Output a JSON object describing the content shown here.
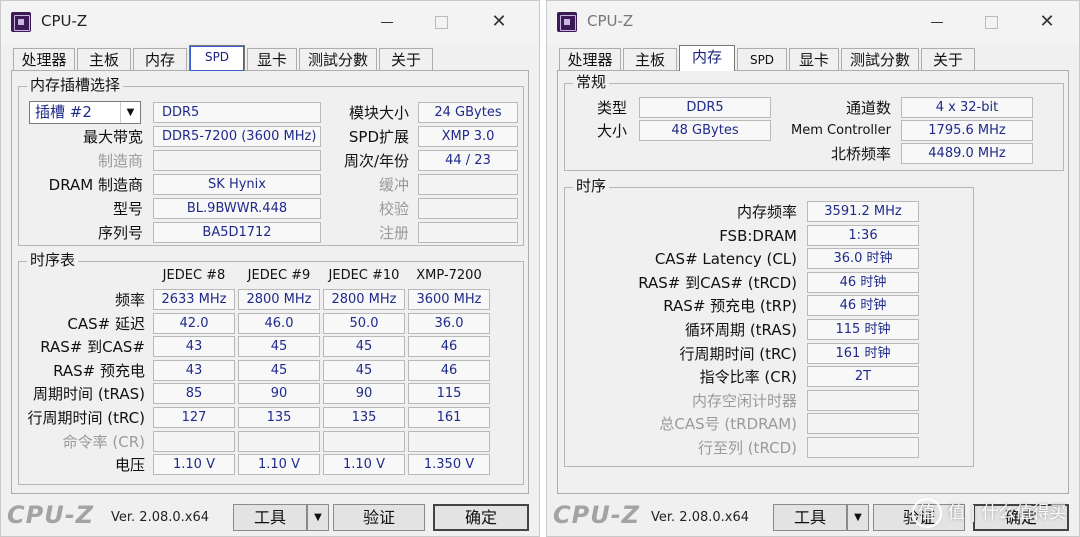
{
  "left": {
    "window_title": "CPU-Z",
    "tabs": [
      "处理器",
      "主板",
      "内存",
      "SPD",
      "显卡",
      "测試分數",
      "关于"
    ],
    "active_tab": "SPD",
    "slot_group_title": "内存插槽选择",
    "slot_select": "插槽 #2",
    "memory_type": "DDR5",
    "labels": {
      "module_size": "模块大小",
      "max_bandwidth": "最大带宽",
      "spd_ext": "SPD扩展",
      "manufacturer": "制造商",
      "week_year": "周次/年份",
      "dram_mfr": "DRAM 制造商",
      "buffered": "缓冲",
      "part_number": "型号",
      "correction": "校验",
      "serial_number": "序列号",
      "registered": "注册"
    },
    "values": {
      "module_size": "24 GBytes",
      "max_bandwidth": "DDR5-7200 (3600 MHz)",
      "spd_ext": "XMP 3.0",
      "manufacturer": "",
      "week_year": "44 / 23",
      "dram_mfr": "SK Hynix",
      "buffered": "",
      "part_number": "BL.9BWWR.448",
      "correction": "",
      "serial_number": "BA5D1712",
      "registered": ""
    },
    "timings_title": "时序表",
    "timing_columns": [
      "JEDEC #8",
      "JEDEC #9",
      "JEDEC #10",
      "XMP-7200"
    ],
    "timing_rows": [
      {
        "label": "频率",
        "values": [
          "2633 MHz",
          "2800 MHz",
          "2800 MHz",
          "3600 MHz"
        ],
        "dim": false
      },
      {
        "label": "CAS# 延迟",
        "values": [
          "42.0",
          "46.0",
          "50.0",
          "36.0"
        ],
        "dim": false
      },
      {
        "label": "RAS# 到CAS#",
        "values": [
          "43",
          "45",
          "45",
          "46"
        ],
        "dim": false
      },
      {
        "label": "RAS# 预充电",
        "values": [
          "43",
          "45",
          "45",
          "46"
        ],
        "dim": false
      },
      {
        "label": "周期时间 (tRAS)",
        "values": [
          "85",
          "90",
          "90",
          "115"
        ],
        "dim": false
      },
      {
        "label": "行周期时间 (tRC)",
        "values": [
          "127",
          "135",
          "135",
          "161"
        ],
        "dim": false
      },
      {
        "label": "命令率 (CR)",
        "values": [
          "",
          "",
          "",
          ""
        ],
        "dim": true
      },
      {
        "label": "电压",
        "values": [
          "1.10 V",
          "1.10 V",
          "1.10 V",
          "1.350 V"
        ],
        "dim": false
      }
    ],
    "footer": {
      "logo": "CPU-Z",
      "version": "Ver. 2.08.0.x64",
      "tools_button": "工具",
      "validate_button": "验证",
      "ok_button": "确定"
    }
  },
  "right": {
    "window_title": "CPU-Z",
    "tabs": [
      "处理器",
      "主板",
      "内存",
      "SPD",
      "显卡",
      "测試分數",
      "关于"
    ],
    "active_tab": "内存",
    "general_title": "常规",
    "general": {
      "type_label": "类型",
      "type_value": "DDR5",
      "channels_label": "通道数",
      "channels_value": "4 x 32-bit",
      "size_label": "大小",
      "size_value": "48 GBytes",
      "mem_controller_label": "Mem Controller",
      "mem_controller_value": "1795.6 MHz",
      "nb_freq_label": "北桥频率",
      "nb_freq_value": "4489.0 MHz"
    },
    "timings_title": "时序",
    "timings": [
      {
        "label": "内存频率",
        "value": "3591.2 MHz",
        "dim": false
      },
      {
        "label": "FSB:DRAM",
        "value": "1:36",
        "dim": false
      },
      {
        "label": "CAS# Latency (CL)",
        "value": "36.0 时钟",
        "dim": false
      },
      {
        "label": "RAS# 到CAS# (tRCD)",
        "value": "46 时钟",
        "dim": false
      },
      {
        "label": "RAS# 预充电 (tRP)",
        "value": "46 时钟",
        "dim": false
      },
      {
        "label": "循环周期 (tRAS)",
        "value": "115 时钟",
        "dim": false
      },
      {
        "label": "行周期时间 (tRC)",
        "value": "161 时钟",
        "dim": false
      },
      {
        "label": "指令比率 (CR)",
        "value": "2T",
        "dim": false
      },
      {
        "label": "内存空闲计时器",
        "value": "",
        "dim": true
      },
      {
        "label": "总CAS号 (tRDRAM)",
        "value": "",
        "dim": true
      },
      {
        "label": "行至列 (tRCD)",
        "value": "",
        "dim": true
      }
    ],
    "footer": {
      "logo": "CPU-Z",
      "version": "Ver. 2.08.0.x64",
      "tools_button": "工具",
      "validate_button": "验证",
      "ok_button": "确定"
    }
  },
  "watermark": "值 | 什么值得买",
  "icons": {
    "app": "cpu-z-chip-icon",
    "minimize": "minimize-icon",
    "maximize": "maximize-icon",
    "close": "close-icon",
    "dropdown": "chevron-down-icon"
  }
}
